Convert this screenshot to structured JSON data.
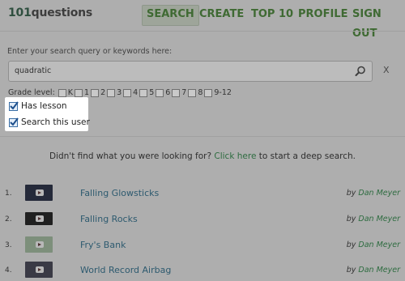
{
  "header": {
    "logo_num": "101",
    "logo_word": "questions",
    "nav": [
      "SEARCH",
      "CREATE",
      "TOP 10",
      "PROFILE",
      "SIGN OUT"
    ],
    "active_nav": "SEARCH"
  },
  "search": {
    "label": "Enter your search query or keywords here:",
    "value": "quadratic",
    "clear": "X"
  },
  "grades": {
    "label": "Grade level:",
    "items": [
      "K",
      "1",
      "2",
      "3",
      "4",
      "5",
      "6",
      "7",
      "8",
      "9-12"
    ]
  },
  "options": [
    {
      "label": "Has lesson",
      "checked": true
    },
    {
      "label": "Search this user",
      "checked": true
    }
  ],
  "deep_search": {
    "prefix": "Didn't find what you were looking for?",
    "link": "Click here",
    "suffix": "to start a deep search."
  },
  "results": [
    {
      "num": "1.",
      "title": "Falling Glowsticks",
      "by": "by",
      "author": "Dan Meyer"
    },
    {
      "num": "2.",
      "title": "Falling Rocks",
      "by": "by",
      "author": "Dan Meyer"
    },
    {
      "num": "3.",
      "title": "Fry's Bank",
      "by": "by",
      "author": "Dan Meyer"
    },
    {
      "num": "4.",
      "title": "World Record Airbag",
      "by": "by",
      "author": "Dan Meyer"
    }
  ],
  "colors": {
    "overlay_bg": "#aeaeae",
    "nav_green": "#3f6a33",
    "link_green": "#2e6c40",
    "title_blue": "#2d5a6f",
    "highlight": "#ffffff"
  }
}
